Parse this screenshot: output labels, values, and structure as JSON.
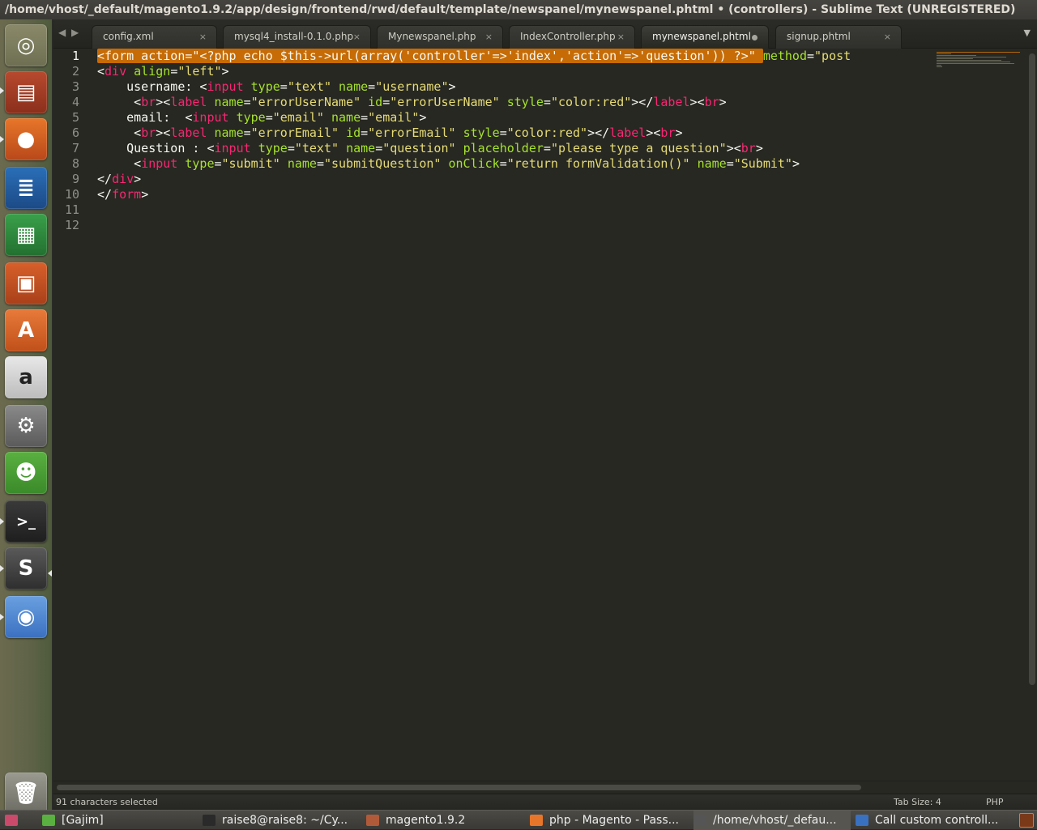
{
  "window": {
    "title": "/home/vhost/_default/magento1.9.2/app/design/frontend/rwd/default/template/newspanel/mynewspanel.phtml • (controllers) - Sublime Text (UNREGISTERED)"
  },
  "launcher": {
    "items": [
      {
        "name": "dash-home",
        "icon": "ubuntu-logo-icon"
      },
      {
        "name": "files",
        "icon": "file-cabinet-icon"
      },
      {
        "name": "firefox",
        "icon": "firefox-icon"
      },
      {
        "name": "writer",
        "icon": "libreoffice-writer-icon"
      },
      {
        "name": "calc",
        "icon": "libreoffice-calc-icon"
      },
      {
        "name": "impress",
        "icon": "libreoffice-impress-icon"
      },
      {
        "name": "software-center",
        "icon": "shopping-bag-icon"
      },
      {
        "name": "amazon",
        "icon": "amazon-icon"
      },
      {
        "name": "system-settings",
        "icon": "wrench-gear-icon"
      },
      {
        "name": "gajim",
        "icon": "gajim-lightbulb-icon"
      },
      {
        "name": "terminal",
        "icon": "terminal-icon"
      },
      {
        "name": "sublime-text",
        "icon": "sublime-text-icon"
      },
      {
        "name": "chromium",
        "icon": "chromium-icon"
      },
      {
        "name": "trash",
        "icon": "trash-icon"
      }
    ]
  },
  "tabs": [
    {
      "label": "config.xml",
      "dirty": false,
      "active": false
    },
    {
      "label": "mysql4_install-0.1.0.php",
      "dirty": false,
      "active": false
    },
    {
      "label": "Mynewspanel.php",
      "dirty": false,
      "active": false
    },
    {
      "label": "IndexController.php",
      "dirty": false,
      "active": false
    },
    {
      "label": "mynewspanel.phtml",
      "dirty": true,
      "active": true
    },
    {
      "label": "signup.phtml",
      "dirty": false,
      "active": false
    }
  ],
  "tab_close_glyph": "×",
  "editor": {
    "line_numbers": [
      "1",
      "2",
      "3",
      "4",
      "5",
      "6",
      "7",
      "8",
      "9",
      "10",
      "11",
      "12"
    ],
    "current_line": 1,
    "lines": [
      [
        {
          "t": "<form action=\"<?php echo $this->url(array('controller'=>'index','action'=>'question')) ?>\" ",
          "c": "sel"
        },
        {
          "t": "method",
          "c": "at"
        },
        {
          "t": "=",
          "c": ""
        },
        {
          "t": "\"post",
          "c": "st"
        }
      ],
      [
        {
          "t": "<",
          "c": ""
        },
        {
          "t": "div",
          "c": "tg"
        },
        {
          "t": " ",
          "c": ""
        },
        {
          "t": "align",
          "c": "at"
        },
        {
          "t": "=",
          "c": ""
        },
        {
          "t": "\"left\"",
          "c": "st"
        },
        {
          "t": ">",
          "c": ""
        }
      ],
      [
        {
          "t": "    username: <",
          "c": ""
        },
        {
          "t": "input",
          "c": "tg"
        },
        {
          "t": " ",
          "c": ""
        },
        {
          "t": "type",
          "c": "at"
        },
        {
          "t": "=",
          "c": ""
        },
        {
          "t": "\"text\"",
          "c": "st"
        },
        {
          "t": " ",
          "c": ""
        },
        {
          "t": "name",
          "c": "at"
        },
        {
          "t": "=",
          "c": ""
        },
        {
          "t": "\"username\"",
          "c": "st"
        },
        {
          "t": ">",
          "c": ""
        }
      ],
      [
        {
          "t": "     <",
          "c": ""
        },
        {
          "t": "br",
          "c": "tg"
        },
        {
          "t": "><",
          "c": ""
        },
        {
          "t": "label",
          "c": "tg"
        },
        {
          "t": " ",
          "c": ""
        },
        {
          "t": "name",
          "c": "at"
        },
        {
          "t": "=",
          "c": ""
        },
        {
          "t": "\"errorUserName\"",
          "c": "st"
        },
        {
          "t": " ",
          "c": ""
        },
        {
          "t": "id",
          "c": "at"
        },
        {
          "t": "=",
          "c": ""
        },
        {
          "t": "\"errorUserName\"",
          "c": "st"
        },
        {
          "t": " ",
          "c": ""
        },
        {
          "t": "style",
          "c": "at"
        },
        {
          "t": "=",
          "c": ""
        },
        {
          "t": "\"color:red\"",
          "c": "st"
        },
        {
          "t": "></",
          "c": ""
        },
        {
          "t": "label",
          "c": "tg"
        },
        {
          "t": "><",
          "c": ""
        },
        {
          "t": "br",
          "c": "tg"
        },
        {
          "t": ">",
          "c": ""
        }
      ],
      [
        {
          "t": "    email:  <",
          "c": ""
        },
        {
          "t": "input",
          "c": "tg"
        },
        {
          "t": " ",
          "c": ""
        },
        {
          "t": "type",
          "c": "at"
        },
        {
          "t": "=",
          "c": ""
        },
        {
          "t": "\"email\"",
          "c": "st"
        },
        {
          "t": " ",
          "c": ""
        },
        {
          "t": "name",
          "c": "at"
        },
        {
          "t": "=",
          "c": ""
        },
        {
          "t": "\"email\"",
          "c": "st"
        },
        {
          "t": ">",
          "c": ""
        }
      ],
      [
        {
          "t": "     <",
          "c": ""
        },
        {
          "t": "br",
          "c": "tg"
        },
        {
          "t": "><",
          "c": ""
        },
        {
          "t": "label",
          "c": "tg"
        },
        {
          "t": " ",
          "c": ""
        },
        {
          "t": "name",
          "c": "at"
        },
        {
          "t": "=",
          "c": ""
        },
        {
          "t": "\"errorEmail\"",
          "c": "st"
        },
        {
          "t": " ",
          "c": ""
        },
        {
          "t": "id",
          "c": "at"
        },
        {
          "t": "=",
          "c": ""
        },
        {
          "t": "\"errorEmail\"",
          "c": "st"
        },
        {
          "t": " ",
          "c": ""
        },
        {
          "t": "style",
          "c": "at"
        },
        {
          "t": "=",
          "c": ""
        },
        {
          "t": "\"color:red\"",
          "c": "st"
        },
        {
          "t": "></",
          "c": ""
        },
        {
          "t": "label",
          "c": "tg"
        },
        {
          "t": "><",
          "c": ""
        },
        {
          "t": "br",
          "c": "tg"
        },
        {
          "t": ">",
          "c": ""
        }
      ],
      [
        {
          "t": "    Question : <",
          "c": ""
        },
        {
          "t": "input",
          "c": "tg"
        },
        {
          "t": " ",
          "c": ""
        },
        {
          "t": "type",
          "c": "at"
        },
        {
          "t": "=",
          "c": ""
        },
        {
          "t": "\"text\"",
          "c": "st"
        },
        {
          "t": " ",
          "c": ""
        },
        {
          "t": "name",
          "c": "at"
        },
        {
          "t": "=",
          "c": ""
        },
        {
          "t": "\"question\"",
          "c": "st"
        },
        {
          "t": " ",
          "c": ""
        },
        {
          "t": "placeholder",
          "c": "at"
        },
        {
          "t": "=",
          "c": ""
        },
        {
          "t": "\"please type a question\"",
          "c": "st"
        },
        {
          "t": "><",
          "c": ""
        },
        {
          "t": "br",
          "c": "tg"
        },
        {
          "t": ">",
          "c": ""
        }
      ],
      [
        {
          "t": "     <",
          "c": ""
        },
        {
          "t": "input",
          "c": "tg"
        },
        {
          "t": " ",
          "c": ""
        },
        {
          "t": "type",
          "c": "at"
        },
        {
          "t": "=",
          "c": ""
        },
        {
          "t": "\"submit\"",
          "c": "st"
        },
        {
          "t": " ",
          "c": ""
        },
        {
          "t": "name",
          "c": "at"
        },
        {
          "t": "=",
          "c": ""
        },
        {
          "t": "\"submitQuestion\"",
          "c": "st"
        },
        {
          "t": " ",
          "c": ""
        },
        {
          "t": "onClick",
          "c": "at"
        },
        {
          "t": "=",
          "c": ""
        },
        {
          "t": "\"return formValidation()\"",
          "c": "st"
        },
        {
          "t": " ",
          "c": ""
        },
        {
          "t": "name",
          "c": "at"
        },
        {
          "t": "=",
          "c": ""
        },
        {
          "t": "\"Submit\"",
          "c": "st"
        },
        {
          "t": ">",
          "c": ""
        }
      ],
      [
        {
          "t": "</",
          "c": ""
        },
        {
          "t": "div",
          "c": "tg"
        },
        {
          "t": ">",
          "c": ""
        }
      ],
      [
        {
          "t": "</",
          "c": ""
        },
        {
          "t": "form",
          "c": "tg"
        },
        {
          "t": ">",
          "c": ""
        }
      ],
      [],
      []
    ]
  },
  "status": {
    "selection": "91 characters selected",
    "tab_size": "Tab Size: 4",
    "syntax": "PHP"
  },
  "taskbar": {
    "items": [
      {
        "label": "[Gajim]",
        "icon": "gajim-icon",
        "active": false
      },
      {
        "label": "raise8@raise8: ~/Cy...",
        "icon": "terminal-icon",
        "active": false
      },
      {
        "label": "magento1.9.2",
        "icon": "folder-icon",
        "active": false
      },
      {
        "label": "php - Magento - Pass...",
        "icon": "firefox-icon",
        "active": false
      },
      {
        "label": "/home/vhost/_defau...",
        "icon": "sublime-icon",
        "active": true
      },
      {
        "label": "Call custom controll...",
        "icon": "chromium-icon",
        "active": false
      }
    ]
  },
  "colors": {
    "editor_bg": "#272822",
    "selection": "#c66b05",
    "tag": "#f92672",
    "attribute": "#a6e22e",
    "string": "#e6db74",
    "foreground": "#f8f8f2"
  }
}
